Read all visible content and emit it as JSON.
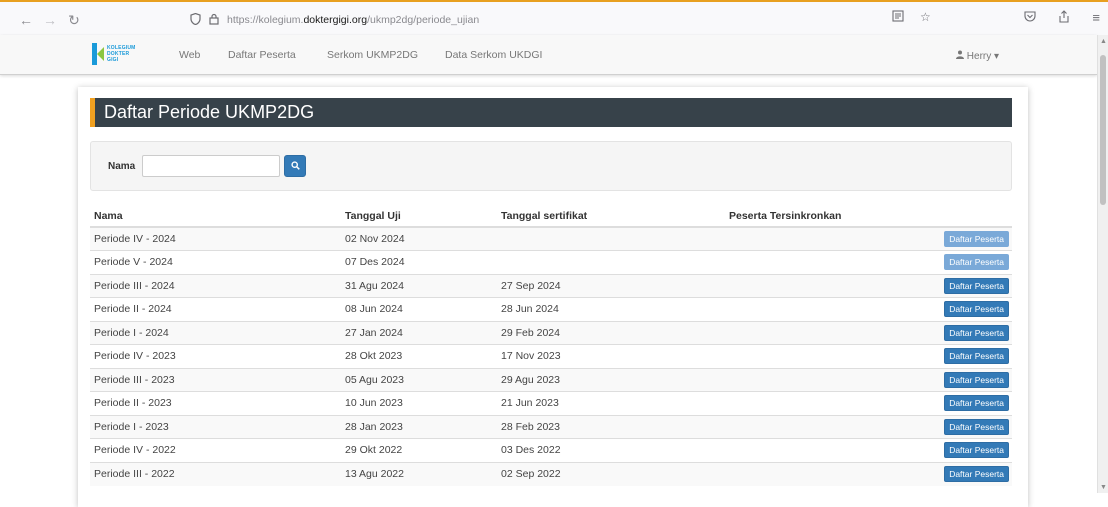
{
  "browser": {
    "url_prefix": "https://kolegium.",
    "url_host": "doktergigi.org",
    "url_path": "/ukmp2dg/periode_ujian"
  },
  "logo": {
    "line1": "KOLEGIUM",
    "line2": "DOKTER",
    "line3": "GIGI"
  },
  "nav": {
    "items": [
      "Web",
      "Daftar Peserta",
      "Serkom UKMP2DG",
      "Data Serkom UKDGI"
    ],
    "user": "Herry"
  },
  "page": {
    "title": "Daftar Periode UKMP2DG"
  },
  "search": {
    "label": "Nama",
    "value": ""
  },
  "table": {
    "headers": [
      "Nama",
      "Tanggal Uji",
      "Tanggal sertifikat",
      "Peserta Tersinkronkan",
      ""
    ],
    "button_label": "Daftar Peserta",
    "rows": [
      {
        "nama": "Periode IV - 2024",
        "uji": "02 Nov 2024",
        "sertifikat": "",
        "sinkron": "",
        "disabled": true
      },
      {
        "nama": "Periode V - 2024",
        "uji": "07 Des 2024",
        "sertifikat": "",
        "sinkron": "",
        "disabled": true
      },
      {
        "nama": "Periode III - 2024",
        "uji": "31 Agu 2024",
        "sertifikat": "27 Sep 2024",
        "sinkron": "",
        "disabled": false
      },
      {
        "nama": "Periode II - 2024",
        "uji": "08 Jun 2024",
        "sertifikat": "28 Jun 2024",
        "sinkron": "",
        "disabled": false
      },
      {
        "nama": "Periode I - 2024",
        "uji": "27 Jan 2024",
        "sertifikat": "29 Feb 2024",
        "sinkron": "",
        "disabled": false
      },
      {
        "nama": "Periode IV - 2023",
        "uji": "28 Okt 2023",
        "sertifikat": "17 Nov 2023",
        "sinkron": "",
        "disabled": false
      },
      {
        "nama": "Periode III - 2023",
        "uji": "05 Agu 2023",
        "sertifikat": "29 Agu 2023",
        "sinkron": "",
        "disabled": false
      },
      {
        "nama": "Periode II - 2023",
        "uji": "10 Jun 2023",
        "sertifikat": "21 Jun 2023",
        "sinkron": "",
        "disabled": false
      },
      {
        "nama": "Periode I - 2023",
        "uji": "28 Jan 2023",
        "sertifikat": "28 Feb 2023",
        "sinkron": "",
        "disabled": false
      },
      {
        "nama": "Periode IV - 2022",
        "uji": "29 Okt 2022",
        "sertifikat": "03 Des 2022",
        "sinkron": "",
        "disabled": false
      },
      {
        "nama": "Periode III - 2022",
        "uji": "13 Agu 2022",
        "sertifikat": "02 Sep 2022",
        "sinkron": "",
        "disabled": false
      }
    ]
  }
}
